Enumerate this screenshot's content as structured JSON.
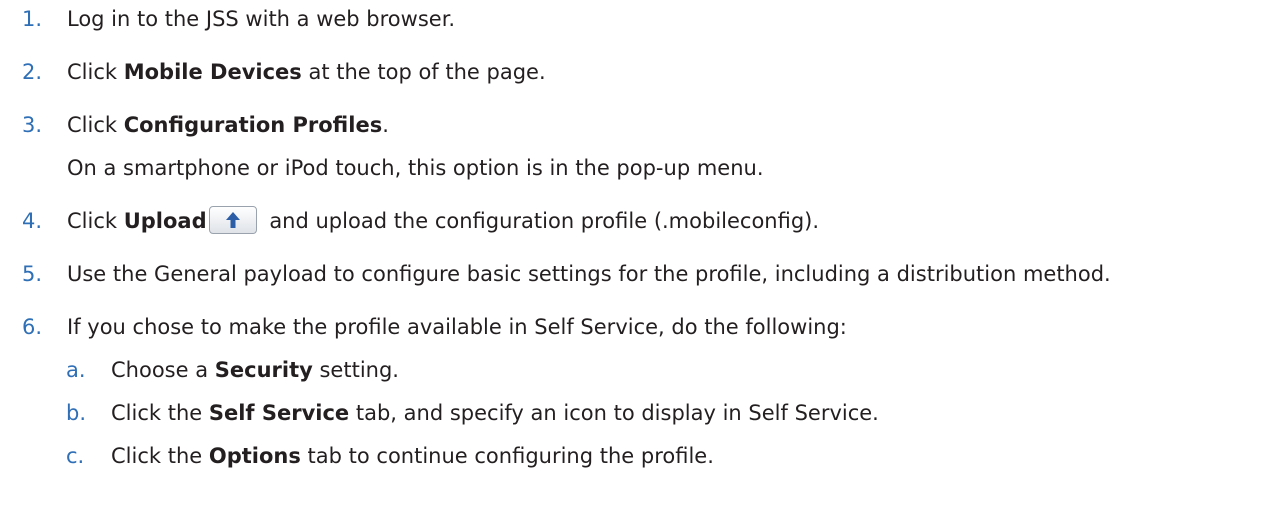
{
  "steps": [
    {
      "num": "1.",
      "text": "Log in to the JSS with a web browser."
    },
    {
      "num": "2.",
      "pre": "Click ",
      "bold": "Mobile Devices",
      "post": " at the top of the page."
    },
    {
      "num": "3.",
      "pre": "Click ",
      "bold": "Configuration Profiles",
      "post": ".",
      "note": "On a smartphone or iPod touch, this option is in the pop-up menu."
    },
    {
      "num": "4.",
      "pre": "Click ",
      "bold": "Upload",
      "post": " and upload the configuration profile (.mobileconfig).",
      "button_icon": "upload-arrow-icon"
    },
    {
      "num": "5.",
      "text": "Use the General payload to configure basic settings for the profile, including a distribution method."
    },
    {
      "num": "6.",
      "text": "If you chose to make the profile available in Self Service, do the following:"
    }
  ],
  "substeps": [
    {
      "letter": "a.",
      "pre": "Choose a ",
      "bold": "Security",
      "post": " setting."
    },
    {
      "letter": "b.",
      "pre": "Click the ",
      "bold": "Self Service",
      "post": " tab, and specify an icon to display in Self Service."
    },
    {
      "letter": "c.",
      "pre": "Click the ",
      "bold": "Options",
      "post": " tab to continue configuring the profile."
    }
  ],
  "colors": {
    "number": "#2f6fb6",
    "text": "#231f20",
    "button_arrow": "#2b5ea7"
  }
}
